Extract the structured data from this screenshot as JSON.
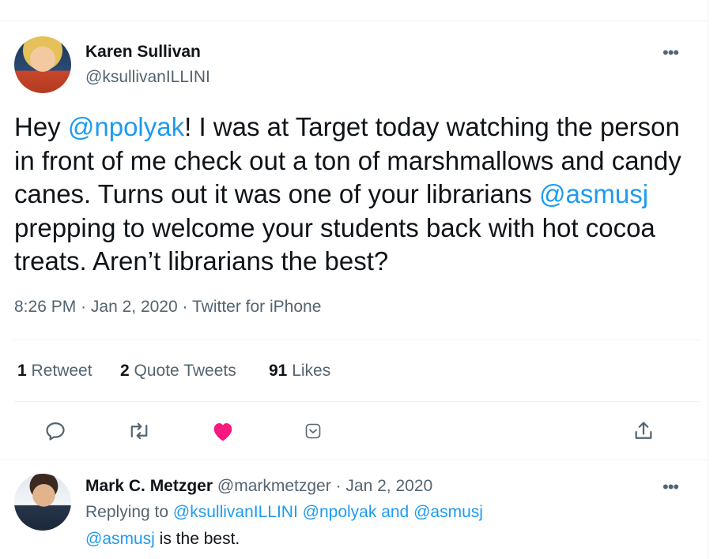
{
  "tweet": {
    "author_name": "Karen Sullivan",
    "author_handle": "@ksullivanILLINI",
    "more_label": "•••",
    "text_parts": {
      "p1": "Hey ",
      "mention1": "@npolyak",
      "p2": "! I was at Target today watching the person in front of me check out a ton of marshmallows and candy canes. Turns out it was one of your librarians ",
      "mention2": "@asmusj",
      "p3": " prepping to welcome your students back with hot cocoa treats. Aren’t librarians the best?"
    },
    "time": "8:26 PM",
    "date": "Jan 2, 2020",
    "source": "Twitter for iPhone",
    "separator": "·"
  },
  "stats": {
    "retweets_count": "1",
    "retweets_label": "Retweet",
    "quotes_count": "2",
    "quotes_label": "Quote Tweets",
    "likes_count": "91",
    "likes_label": "Likes"
  },
  "actions": {
    "icons": [
      "reply-icon",
      "retweet-icon",
      "like-icon",
      "bookmark-icon",
      "share-icon"
    ],
    "like_color": "#f91880",
    "icon_color": "#536471"
  },
  "reply": {
    "author_name": "Mark C. Metzger",
    "author_handle": "@markmetzger",
    "separator": "·",
    "date": "Jan 2, 2020",
    "replying_prefix": "Replying to",
    "replying_mention1": "@ksullivanILLINI",
    "replying_mention2": "@npolyak",
    "replying_and": "and",
    "replying_mention3": "@asmusj",
    "text_mention": "@asmusj",
    "text_rest": " is the best.",
    "more_label": "•••"
  },
  "colors": {
    "accent": "#1d9bf0",
    "secondary_text": "#536471",
    "primary_text": "#0f1419"
  }
}
